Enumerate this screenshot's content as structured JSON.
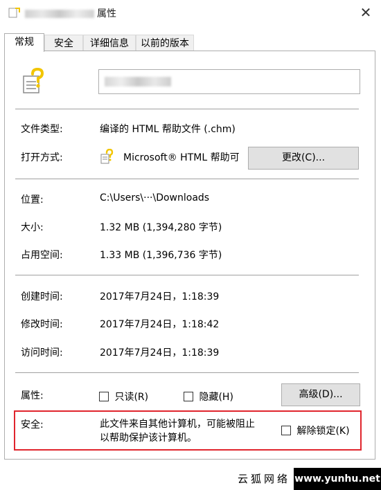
{
  "window": {
    "title": "属性",
    "close_glyph": "✕"
  },
  "tabs": [
    {
      "label": "常规"
    },
    {
      "label": "安全"
    },
    {
      "label": "详细信息"
    },
    {
      "label": "以前的版本"
    }
  ],
  "general": {
    "file_type_label": "文件类型:",
    "file_type_value": "编译的 HTML 帮助文件 (.chm)",
    "opens_with_label": "打开方式:",
    "opens_with_value": "Microsoft® HTML 帮助可",
    "change_button": "更改(C)...",
    "location_label": "位置:",
    "location_value": "C:\\Users\\···\\Downloads",
    "size_label": "大小:",
    "size_value": "1.32 MB (1,394,280 字节)",
    "size_on_disk_label": "占用空间:",
    "size_on_disk_value": "1.33 MB (1,396,736 字节)",
    "created_label": "创建时间:",
    "created_value": "2017年7月24日，1:18:39",
    "modified_label": "修改时间:",
    "modified_value": "2017年7月24日，1:18:42",
    "accessed_label": "访问时间:",
    "accessed_value": "2017年7月24日，1:18:39",
    "attributes_label": "属性:",
    "readonly_label": "只读(R)",
    "hidden_label": "隐藏(H)",
    "advanced_button": "高级(D)...",
    "security_label": "安全:",
    "security_message_line1": "此文件来自其他计算机，可能被阻止",
    "security_message_line2": "以帮助保护该计算机。",
    "unblock_label": "解除锁定(K)"
  },
  "watermark": {
    "left_text": "云狐网络",
    "right_text": "www.yunhu.net"
  },
  "colors": {
    "highlight_border": "#e0242c",
    "button_bg": "#e1e1e1",
    "icon_yellow": "#f2c500"
  }
}
